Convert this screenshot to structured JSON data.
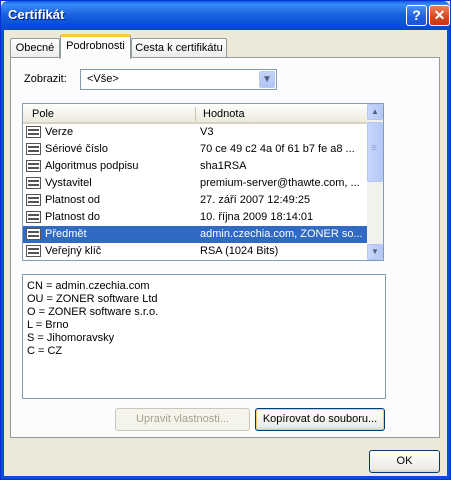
{
  "window": {
    "title": "Certifikát",
    "help_glyph": "?",
    "close_glyph": "✕"
  },
  "tabs": [
    {
      "label": "Obecné"
    },
    {
      "label": "Podrobnosti"
    },
    {
      "label": "Cesta k certifikátu"
    }
  ],
  "show": {
    "label": "Zobrazit:",
    "selected": "<Vše>"
  },
  "list": {
    "columns": [
      "Pole",
      "Hodnota"
    ],
    "rows": [
      {
        "field": "Verze",
        "value": "V3"
      },
      {
        "field": "Sériové číslo",
        "value": "70 ce 49 c2 4a 0f 61 b7 fe a8 ..."
      },
      {
        "field": "Algoritmus podpisu",
        "value": "sha1RSA"
      },
      {
        "field": "Vystavitel",
        "value": "premium-server@thawte.com, ..."
      },
      {
        "field": "Platnost od",
        "value": "27. září 2007 12:49:25"
      },
      {
        "field": "Platnost do",
        "value": "10. října 2009 18:14:01"
      },
      {
        "field": "Předmět",
        "value": "admin.czechia.com, ZONER so..."
      },
      {
        "field": "Veřejný klíč",
        "value": "RSA (1024 Bits)"
      }
    ],
    "selected_index": 6
  },
  "detail_lines": [
    "CN = admin.czechia.com",
    "OU = ZONER software Ltd",
    "O = ZONER software s.r.o.",
    "L = Brno",
    "S = Jihomoravsky",
    "C = CZ"
  ],
  "buttons": {
    "edit": "Upravit vlastnosti...",
    "copy": "Kopírovat do souboru...",
    "ok": "OK"
  },
  "colors": {
    "selection": "#316ac5",
    "titlebar": "#0a5fdf",
    "tab_highlight": "#ffc83c"
  }
}
